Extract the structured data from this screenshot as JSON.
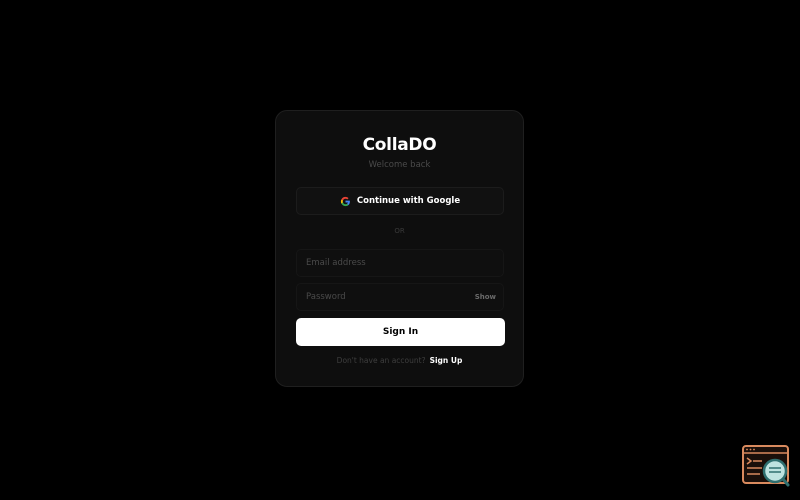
{
  "app": {
    "brand": "CollaDO",
    "subtitle": "Welcome back"
  },
  "auth": {
    "google_label": "Continue with Google",
    "divider": "OR",
    "email_placeholder": "Email address",
    "password_placeholder": "Password",
    "show_label": "Show",
    "signin_label": "Sign In",
    "signup_prompt": "Don't have an account?",
    "signup_link": "Sign Up"
  },
  "icons": {
    "google": "google-g-icon",
    "widget": "devtools-search-icon"
  },
  "colors": {
    "background": "#000000",
    "card": "#0e0e0e",
    "primary_button": "#ffffff",
    "widget_accent": "#d98a5e",
    "widget_lens": "#3c8b8b"
  }
}
